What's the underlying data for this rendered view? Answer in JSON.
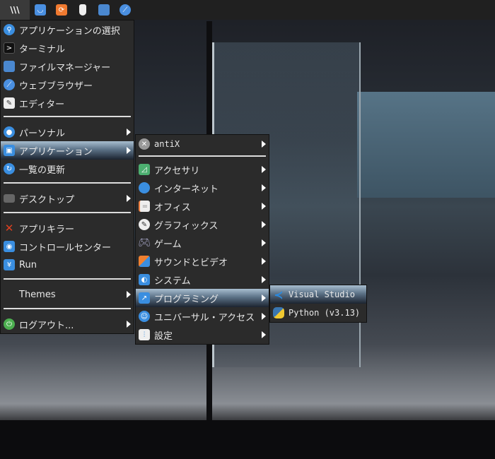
{
  "taskbar": {
    "start_label": "\\\\\\",
    "icons": [
      "store-icon",
      "update-icon",
      "usb-icon",
      "folder-icon",
      "browser-icon"
    ]
  },
  "main_menu": {
    "items": [
      {
        "label": "アプリケーションの選択",
        "icon": "search-icon"
      },
      {
        "label": "ターミナル",
        "icon": "terminal-icon"
      },
      {
        "label": "ファイルマネージャー",
        "icon": "folder-icon"
      },
      {
        "label": "ウェブブラウザー",
        "icon": "browser-icon"
      },
      {
        "label": "エディター",
        "icon": "editor-icon"
      },
      {
        "label": "パーソナル",
        "icon": "user-icon"
      },
      {
        "label": "アプリケーション",
        "icon": "apps-icon"
      },
      {
        "label": "一覧の更新",
        "icon": "refresh-icon"
      },
      {
        "label": "デスクトップ",
        "icon": "desktop-icon"
      },
      {
        "label": "アプリキラー",
        "icon": "kill-icon"
      },
      {
        "label": "コントロールセンター",
        "icon": "control-icon"
      },
      {
        "label": "Run",
        "icon": "run-icon"
      },
      {
        "label": "Themes",
        "icon": ""
      },
      {
        "label": "ログアウト...",
        "icon": "power-icon"
      }
    ]
  },
  "apps_menu": {
    "items": [
      {
        "label": "antiX"
      },
      {
        "label": "アクセサリ"
      },
      {
        "label": "インターネット"
      },
      {
        "label": "オフィス"
      },
      {
        "label": "グラフィックス"
      },
      {
        "label": "ゲーム"
      },
      {
        "label": "サウンドとビデオ"
      },
      {
        "label": "システム"
      },
      {
        "label": "プログラミング"
      },
      {
        "label": "ユニバーサル・アクセス"
      },
      {
        "label": "設定"
      }
    ]
  },
  "programming_menu": {
    "items": [
      {
        "label": "Visual Studio"
      },
      {
        "label": "Python (v3.13)"
      }
    ]
  }
}
